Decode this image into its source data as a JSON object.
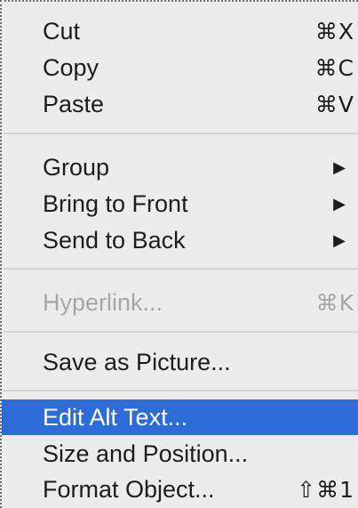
{
  "menu": {
    "items": [
      {
        "label": "Cut",
        "shortcut": "⌘X"
      },
      {
        "label": "Copy",
        "shortcut": "⌘C"
      },
      {
        "label": "Paste",
        "shortcut": "⌘V"
      },
      {
        "label": "Group",
        "submenu_icon": "submenu-arrow-icon"
      },
      {
        "label": "Bring to Front",
        "submenu_icon": "submenu-arrow-icon"
      },
      {
        "label": "Send to Back",
        "submenu_icon": "submenu-arrow-icon"
      },
      {
        "label": "Hyperlink...",
        "shortcut": "⌘K",
        "state": "disabled"
      },
      {
        "label": "Save as Picture..."
      },
      {
        "label": "Edit Alt Text...",
        "state": "highlighted"
      },
      {
        "label": "Size and Position..."
      },
      {
        "label": "Format Object...",
        "shortcut": "⇧⌘1"
      }
    ]
  },
  "colors": {
    "menu_background": "#ececec",
    "text": "#1d1d1d",
    "disabled_text": "#a6a6a6",
    "highlight": "#2d6bd6",
    "highlight_text": "#ffffff",
    "separator": "#d4d4d4"
  }
}
